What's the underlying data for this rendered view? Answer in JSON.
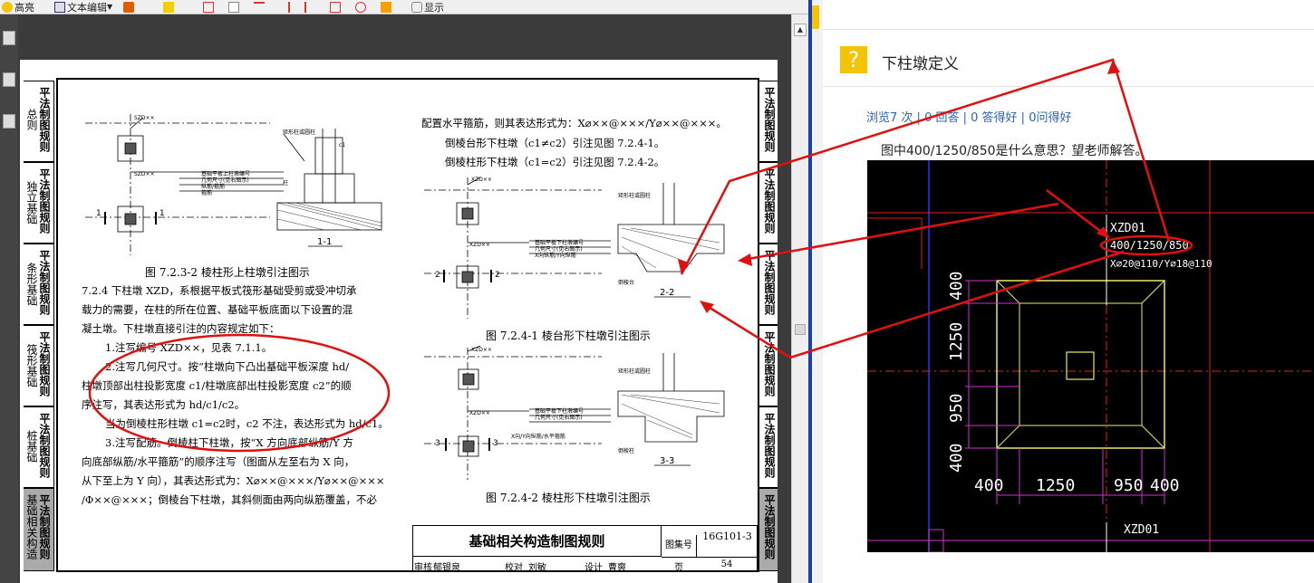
{
  "toolbar": {
    "items": [
      "高亮",
      "文本编辑",
      "显示"
    ]
  },
  "pdf": {
    "left_tabs": [
      {
        "l1": "平法制图规则",
        "l2": "总则"
      },
      {
        "l1": "平法制图规则",
        "l2": "独立基础"
      },
      {
        "l1": "平法制图规则",
        "l2": "条形基础"
      },
      {
        "l1": "平法制图规则",
        "l2": "筏形基础"
      },
      {
        "l1": "平法制图规则",
        "l2": "桩基础"
      },
      {
        "l1": "平法制图规则",
        "l2": "基础相关构造"
      }
    ],
    "right_tabs": [
      "平法制图规则",
      "平法制图规则",
      "平法制图规则",
      "平法制图规则",
      "平法制图规则",
      "平法制图规则"
    ],
    "fig_723_caption": "图 7.2.3-2  棱柱形上柱墩引注图示",
    "fig_723_labels": {
      "szd": "SZD××",
      "l1": "基础平板上柱墩编号",
      "l2": "几何尺寸(见右图示)",
      "l3": "纵筋/箍筋",
      "l4": "箍筋",
      "col_label": "矩形柱或圆柱",
      "zhu": "柱",
      "sec": "1-1",
      "n1": "1",
      "c1": "c1"
    },
    "body_lines": [
      "7.2.4  下柱墩 XZD，系根据平板式筏形基础受剪或受冲切承",
      "载力的需要，在柱的所在位置、基础平板底面以下设置的混",
      "凝土墩。下柱墩直接引注的内容规定如下：",
      "1.注写编号 XZD××，见表 7.1.1。",
      "2.注写几何尺寸。按“柱墩向下凸出基础平板深度  hd/",
      "柱墩顶部出柱投影宽度  c1/柱墩底部出柱投影宽度  c2”的顺",
      "序注写，其表达形式为 hd/c1/c2。",
      "当为倒棱柱形柱墩 c1=c2时，c2 不注，表达形式为 hd/c1。",
      "3.注写配筋。倒棱柱下柱墩，按“X 方向底部纵筋/Y 方",
      "向底部纵筋/水平箍筋”的顺序注写（图面从左至右为 X 向，",
      "从下至上为 Y 向），其表达形式为：X⌀××@×××/Y⌀××@×××",
      "/Φ××@×××；倒棱台下柱墩，其斜侧面由两向纵筋覆盖，不必"
    ],
    "right_lines": [
      "配置水平箍筋，则其表达形式为：X⌀××@×××/Y⌀××@×××。",
      "倒棱台形下柱墩（c1≠c2）引注见图 7.2.4-1。",
      "倒棱柱形下柱墩（c1=c2）引注见图 7.2.4-2。"
    ],
    "fig_7241": {
      "caption": "图 7.2.4-1  棱台形下柱墩引注图示",
      "xzd": "XZD××",
      "l1": "基础平板下柱墩编号",
      "l2": "几何尺寸(见右图示)",
      "l3": "X向纵筋/Y向纵筋",
      "col": "矩形柱或圆柱",
      "bottom": "倒棱台",
      "sec": "2-2",
      "n": "2"
    },
    "fig_7242": {
      "caption": "图 7.2.4-2  棱柱形下柱墩引注图示",
      "xzd": "XZD××",
      "l1": "基础平板下柱墩编号",
      "l2": "几何尺寸(见右图示)",
      "l3": "X向/Y向纵筋/水平箍筋",
      "col": "矩形柱或圆柱",
      "bottom": "倒棱柱",
      "sec": "3-3",
      "n": "3"
    },
    "title_block": {
      "title": "基础相关构造制图规则",
      "atlas_label": "图集号",
      "atlas_no": "16G101-3",
      "review": "审核",
      "reviewer": "郁银泉",
      "check": "校对",
      "checker": "刘敏",
      "design": "设计",
      "designer": "曹爽",
      "page_label": "页",
      "page_no": "54"
    }
  },
  "question": {
    "title": "下柱墩定义",
    "stats": {
      "views": "浏览7 次",
      "sep": " | ",
      "answers": "0 回答",
      "good": "0 答得好",
      "useful": "0问得好"
    },
    "text": "图中400/1250/850是什么意思？望老师解答。"
  },
  "cad": {
    "label1": "XZD01",
    "label2": "400/1250/850",
    "label3": "X⌀20@110/Y⌀18@110",
    "dims_bottom": [
      "400",
      "1250",
      "950",
      "400"
    ],
    "dims_left": [
      "400",
      "1250",
      "950",
      "400"
    ],
    "label_bottom": "XZD01"
  },
  "colors": {
    "annotation_red": "#e01010",
    "cad_yellow": "#e8e86a",
    "cad_magenta": "#cc33cc",
    "cad_blue": "#3030ff",
    "link_blue": "#2d64b3",
    "divider_blue": "#1a3fb0"
  }
}
